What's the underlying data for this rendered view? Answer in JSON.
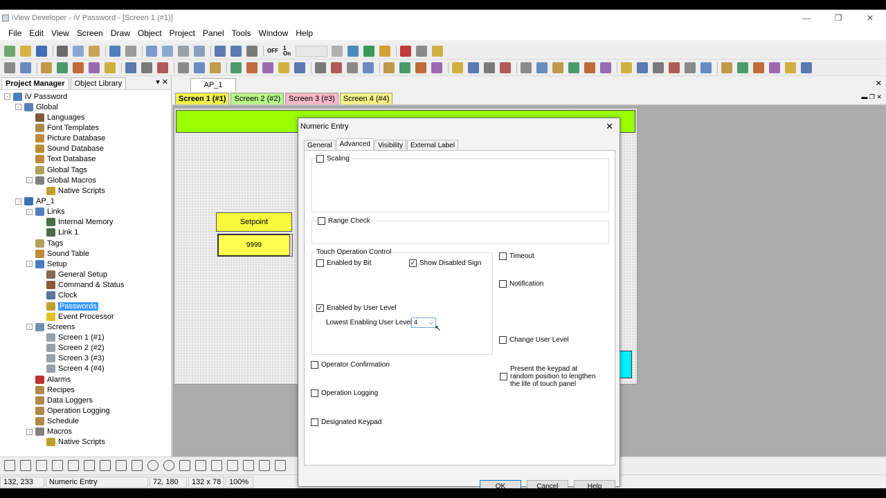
{
  "window": {
    "title": "iView Developer - iV Password - [Screen 1 (#1)]",
    "minimize": "—",
    "maximize": "❐",
    "close": "✕"
  },
  "menu": [
    "File",
    "Edit",
    "View",
    "Screen",
    "Draw",
    "Object",
    "Project",
    "Panel",
    "Tools",
    "Window",
    "Help"
  ],
  "toolbar1": {
    "off_label": "OFF",
    "on_label": "1\nOn"
  },
  "left_pane": {
    "tabs": [
      "Project Manager",
      "Object Library"
    ],
    "controls": "▾ ✕",
    "tree": [
      {
        "label": "iV Password",
        "depth": 0,
        "expander": "-",
        "color": "#4a7cc0"
      },
      {
        "label": "Global",
        "depth": 1,
        "expander": "-",
        "color": "#5c7fb5"
      },
      {
        "label": "Languages",
        "depth": 2,
        "expander": "",
        "color": "#7a5a3a"
      },
      {
        "label": "Font Templates",
        "depth": 2,
        "expander": "",
        "color": "#b08a4a"
      },
      {
        "label": "Picture Database",
        "depth": 2,
        "expander": "",
        "color": "#c08a3a"
      },
      {
        "label": "Sound Database",
        "depth": 2,
        "expander": "",
        "color": "#c08a3a"
      },
      {
        "label": "Text Database",
        "depth": 2,
        "expander": "",
        "color": "#c08a3a"
      },
      {
        "label": "Global Tags",
        "depth": 2,
        "expander": "",
        "color": "#b0a060"
      },
      {
        "label": "Global Macros",
        "depth": 2,
        "expander": "-",
        "color": "#808080"
      },
      {
        "label": "Native Scripts",
        "depth": 3,
        "expander": "",
        "color": "#c0a030"
      },
      {
        "label": "AP_1",
        "depth": 1,
        "expander": "-",
        "color": "#3b6fb8"
      },
      {
        "label": "Links",
        "depth": 2,
        "expander": "-",
        "color": "#5080c0"
      },
      {
        "label": "Internal Memory",
        "depth": 3,
        "expander": "",
        "color": "#4a6a4a"
      },
      {
        "label": "Link 1",
        "depth": 3,
        "expander": "",
        "color": "#4a6a4a"
      },
      {
        "label": "Tags",
        "depth": 2,
        "expander": "",
        "color": "#b0a060"
      },
      {
        "label": "Sound Table",
        "depth": 2,
        "expander": "",
        "color": "#c08a3a"
      },
      {
        "label": "Setup",
        "depth": 2,
        "expander": "-",
        "color": "#4a7cc0"
      },
      {
        "label": "General Setup",
        "depth": 3,
        "expander": "",
        "color": "#806a50"
      },
      {
        "label": "Command & Status",
        "depth": 3,
        "expander": "",
        "color": "#8a5a3a"
      },
      {
        "label": "Clock",
        "depth": 3,
        "expander": "",
        "color": "#6070a0"
      },
      {
        "label": "Passwords",
        "depth": 3,
        "expander": "",
        "color": "#c0a030",
        "selected": true
      },
      {
        "label": "Event Processor",
        "depth": 3,
        "expander": "",
        "color": "#e0c020"
      },
      {
        "label": "Screens",
        "depth": 2,
        "expander": "-",
        "color": "#7090b0"
      },
      {
        "label": "Screen 1 (#1)",
        "depth": 3,
        "expander": "",
        "color": "#9aa0a8"
      },
      {
        "label": "Screen 2 (#2)",
        "depth": 3,
        "expander": "",
        "color": "#9aa0a8"
      },
      {
        "label": "Screen 3 (#3)",
        "depth": 3,
        "expander": "",
        "color": "#9aa0a8"
      },
      {
        "label": "Screen 4 (#4)",
        "depth": 3,
        "expander": "",
        "color": "#9aa0a8"
      },
      {
        "label": "Alarms",
        "depth": 2,
        "expander": "",
        "color": "#c03030"
      },
      {
        "label": "Recipes",
        "depth": 2,
        "expander": "",
        "color": "#b08a4a"
      },
      {
        "label": "Data Loggers",
        "depth": 2,
        "expander": "",
        "color": "#b08a4a"
      },
      {
        "label": "Operation Logging",
        "depth": 2,
        "expander": "",
        "color": "#b08a4a"
      },
      {
        "label": "Schedule",
        "depth": 2,
        "expander": "",
        "color": "#b08a4a"
      },
      {
        "label": "Macros",
        "depth": 2,
        "expander": "-",
        "color": "#808080"
      },
      {
        "label": "Native Scripts",
        "depth": 3,
        "expander": "",
        "color": "#c0a030"
      }
    ]
  },
  "doc": {
    "tab": "AP_1",
    "close": "✕",
    "mdi_controls": "▬ ❐ ✕",
    "screen_tabs": [
      {
        "label": "Screen 1 (#1)",
        "color": "#f2f24a"
      },
      {
        "label": "Screen 2 (#2)",
        "color": "#b8f58a"
      },
      {
        "label": "Screen 3 (#3)",
        "color": "#f7b7c7"
      },
      {
        "label": "Screen 4 (#4)",
        "color": "#f5f08a"
      }
    ],
    "setpoint_label": "Setpoint",
    "numeric_value": "9999"
  },
  "dialog": {
    "title": "Numeric Entry",
    "close": "✕",
    "tabs": [
      "General",
      "Advanced",
      "Visibility",
      "External Label"
    ],
    "active_tab": 1,
    "scaling": "Scaling",
    "range_check": "Range Check",
    "touch_control_title": "Touch Operation Control",
    "enabled_by_bit": "Enabled by Bit",
    "show_disabled_sign": "Show Disabled Sign",
    "enabled_by_user_level": "Enabled by User Level",
    "lowest_level_label": "Lowest Enabling User Level:",
    "lowest_level_value": "4",
    "timeout": "Timeout",
    "notification": "Notification",
    "change_user_level": "Change User Level",
    "operator_confirmation": "Operator Confirmation",
    "random_keypad": "Present the keypad at random position to lengthen the life of touch panel",
    "operation_logging": "Operation Logging",
    "designated_keypad": "Designated Keypad",
    "ok": "OK",
    "cancel": "Cancel",
    "help": "Help",
    "check_mark": "✓"
  },
  "status": [
    "132, 233",
    "Numeric Entry",
    "72, 180",
    "132 x 78",
    "100%"
  ]
}
